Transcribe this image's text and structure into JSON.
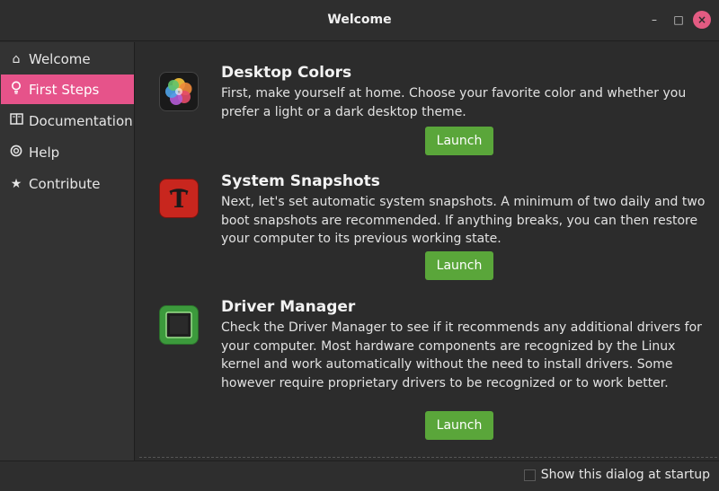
{
  "window": {
    "title": "Welcome"
  },
  "titlebar_buttons": {
    "minimize": "–",
    "maximize": "□",
    "close": "×"
  },
  "sidebar": {
    "items": [
      {
        "label": "Welcome",
        "icon": "⌂",
        "icon_name": "home-icon",
        "active": false
      },
      {
        "label": "First Steps",
        "icon": "♀",
        "icon_name": "lightbulb-icon",
        "active": true
      },
      {
        "label": "Documentation",
        "icon": "📖",
        "icon_name": "book-icon",
        "active": false
      },
      {
        "label": "Help",
        "icon": "⊛",
        "icon_name": "lifebuoy-icon",
        "active": false
      },
      {
        "label": "Contribute",
        "icon": "★",
        "icon_name": "star-icon",
        "active": false
      }
    ],
    "active_color": "#e6538a"
  },
  "sections": [
    {
      "title": "Desktop Colors",
      "description": "First, make yourself at home. Choose your favorite color and whether you prefer a light or a dark desktop theme.",
      "button": "Launch",
      "icon_name": "color-flower-icon"
    },
    {
      "title": "System Snapshots",
      "description": "Next, let's set automatic system snapshots. A minimum of two daily and two boot snapshots are recommended. If anything breaks, you can then restore your computer to its previous working state.",
      "button": "Launch",
      "icon_name": "timeshift-icon"
    },
    {
      "title": "Driver Manager",
      "description": "Check the Driver Manager to see if it recommends any additional drivers for your computer. Most hardware components are recognized by the Linux kernel and work automatically without the need to install drivers. Some however require proprietary drivers to be recognized or to work better.",
      "button": "Launch",
      "icon_name": "chip-icon"
    }
  ],
  "footer": {
    "startup_label": "Show this dialog at startup",
    "startup_checked": false
  },
  "colors": {
    "launch_button": "#5aa63a",
    "close_button": "#e35b82"
  }
}
